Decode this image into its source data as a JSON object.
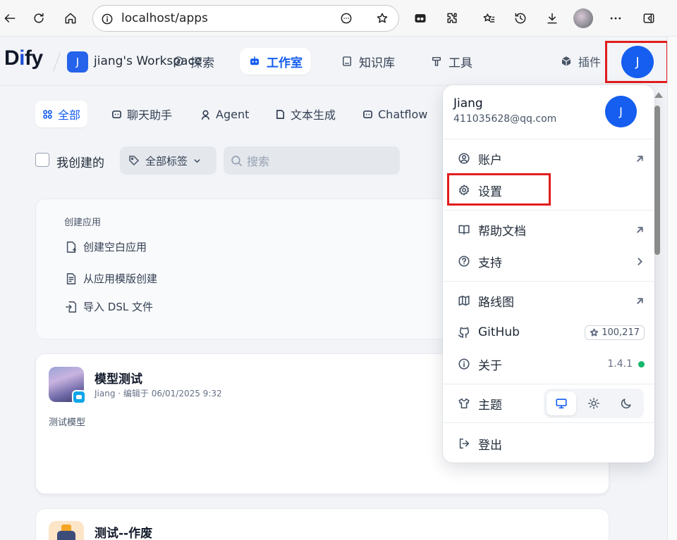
{
  "browser": {
    "url": "localhost/apps",
    "buttons": [
      "back",
      "reload",
      "home",
      "site-info",
      "more",
      "favorite",
      "extension-tamper",
      "extensions",
      "favorites",
      "history",
      "downloads",
      "profile",
      "menu",
      "sidebar"
    ]
  },
  "header": {
    "logo_main": "D",
    "logo_i": "i",
    "logo_rest": "fy",
    "workspace_initial": "J",
    "workspace_name": "jiang's Workspace",
    "nav": {
      "explore": "探索",
      "studio": "工作室",
      "knowledge": "知识库",
      "tools": "工具",
      "plugins": "插件"
    },
    "avatar_initial": "J"
  },
  "tabs": {
    "all": "全部",
    "chat": "聊天助手",
    "agent": "Agent",
    "text": "文本生成",
    "chatflow": "Chatflow"
  },
  "filters": {
    "mine": "我创建的",
    "tags": "全部标签",
    "search_placeholder": "搜索"
  },
  "create": {
    "title": "创建应用",
    "blank": "创建空白应用",
    "template": "从应用模版创建",
    "import": "导入 DSL 文件"
  },
  "apps": [
    {
      "name": "模型测试",
      "meta": "Jiang · 编辑于 06/01/2025 9:32",
      "desc": "测试模型"
    },
    {
      "name": "测试--作废"
    }
  ],
  "menu": {
    "user_name": "Jiang",
    "email": "411035628@qq.com",
    "avatar_initial": "J",
    "account": "账户",
    "settings": "设置",
    "help": "帮助文档",
    "support": "支持",
    "roadmap": "路线图",
    "github": "GitHub",
    "github_stars": "100,217",
    "about": "关于",
    "version": "1.4.1",
    "theme": "主题",
    "logout": "登出"
  },
  "colors": {
    "accent": "#155eef",
    "highlight": "#e11d1d",
    "status_ok": "#12b76a"
  }
}
